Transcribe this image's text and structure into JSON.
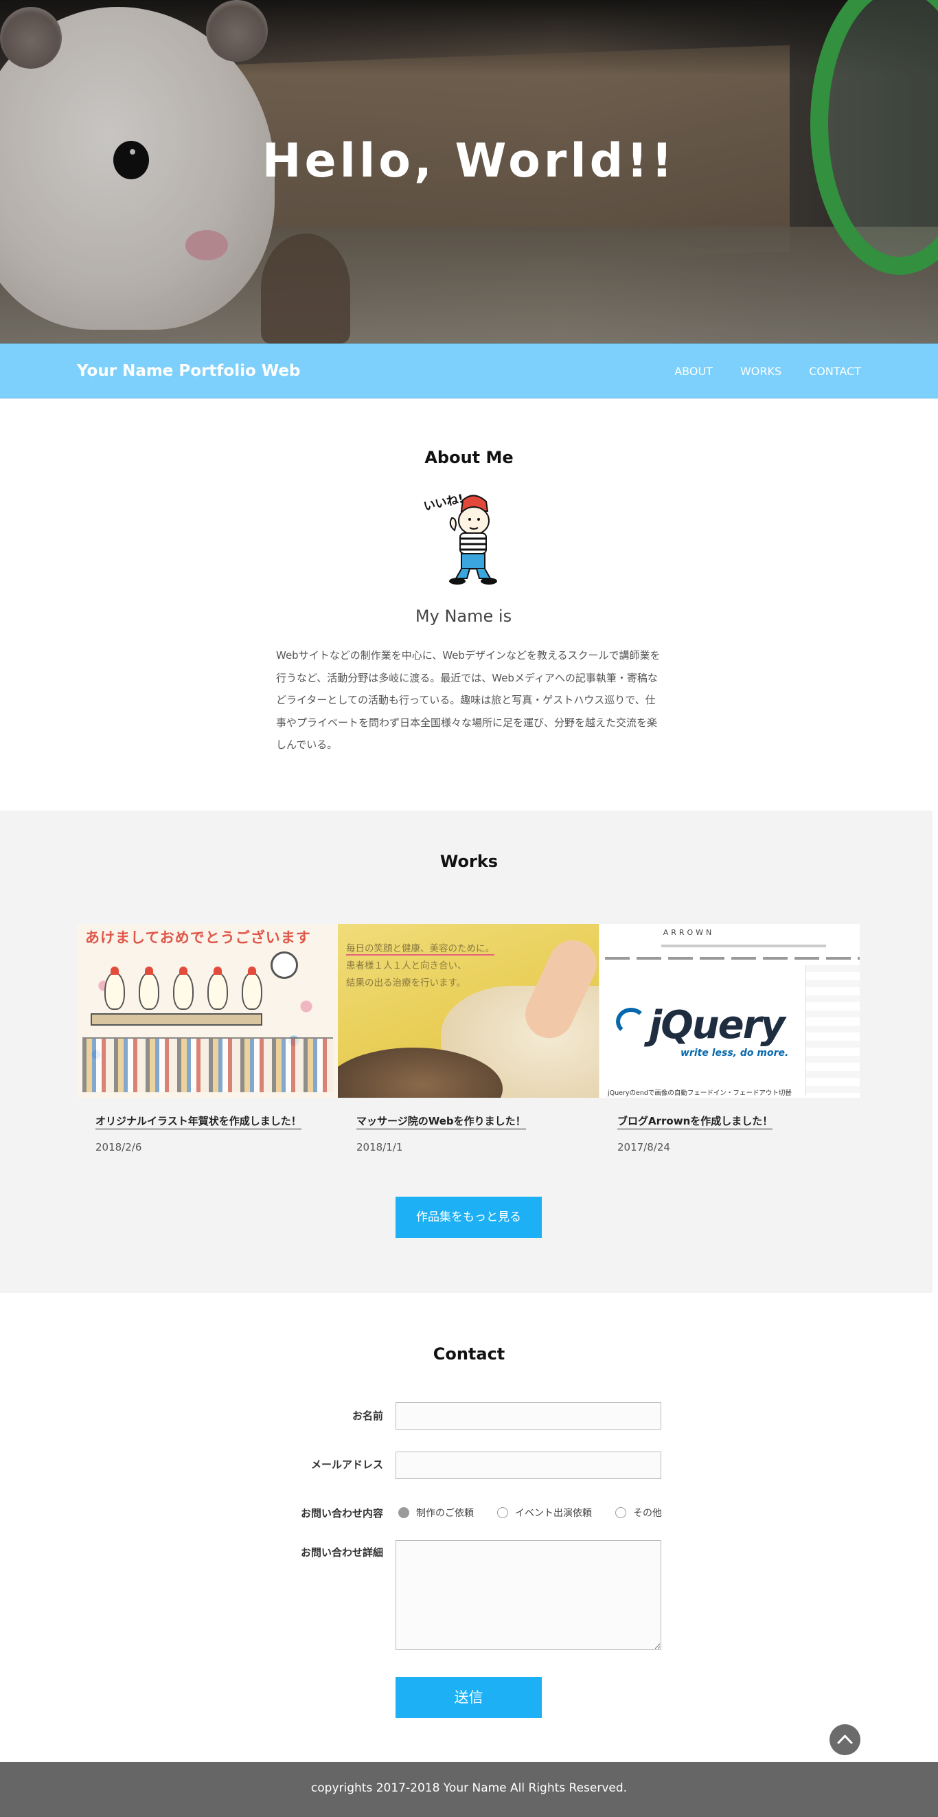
{
  "hero": {
    "title": "Hello, World!!"
  },
  "nav": {
    "brand": "Your Name Portfolio Web",
    "links": [
      "ABOUT",
      "WORKS",
      "CONTACT"
    ],
    "background": "#7dd0fb"
  },
  "about": {
    "title": "About Me",
    "avatar_caption": "いいね!",
    "name_heading": "My Name is",
    "description": "Webサイトなどの制作業を中心に、Webデザインなどを教えるスクールで講師業を行うなど、活動分野は多岐に渡る。最近では、Webメディアへの記事執筆・寄稿などライターとしての活動も行っている。趣味は旅と写真・ゲストハウス巡りで、仕事やプライベートを問わず日本全国様々な場所に足を運び、分野を越えた交流を楽しんでいる。"
  },
  "works": {
    "title": "Works",
    "items": [
      {
        "title": "オリジナルイラスト年賀状を作成しました！",
        "date": "2018/2/6",
        "image_text": "あけましておめでとうございます"
      },
      {
        "title": "マッサージ院のWebを作りました！",
        "date": "2018/1/1",
        "image_lines": [
          "毎日の笑顔と健康、美容のために。",
          "患者様１人１人と向き合い、",
          "結果の出る治療を行います。"
        ]
      },
      {
        "title": "ブログArrownを作成しました！",
        "date": "2017/8/24",
        "image_brand": "ARROWN",
        "image_logo": "jQuery",
        "image_tagline": "write less, do more.",
        "image_caption": "jQueryのendで画像の自動フェードイン・フェードアウト切替"
      }
    ],
    "more_label": "作品集をもっと見る",
    "accent": "#1eb0f5"
  },
  "contact": {
    "title": "Contact",
    "fields": {
      "name_label": "お名前",
      "email_label": "メールアドレス",
      "type_label": "お問い合わせ内容",
      "detail_label": "お問い合わせ詳細"
    },
    "options": [
      "制作のご依頼",
      "イベント出演依頼",
      "その他"
    ],
    "selected_option": "制作のご依頼",
    "submit_label": "送信"
  },
  "icons": {
    "to_top": "chevron-up-icon"
  },
  "footer": {
    "text": "copyrights 2017-2018 Your Name  All Rights Reserved."
  }
}
